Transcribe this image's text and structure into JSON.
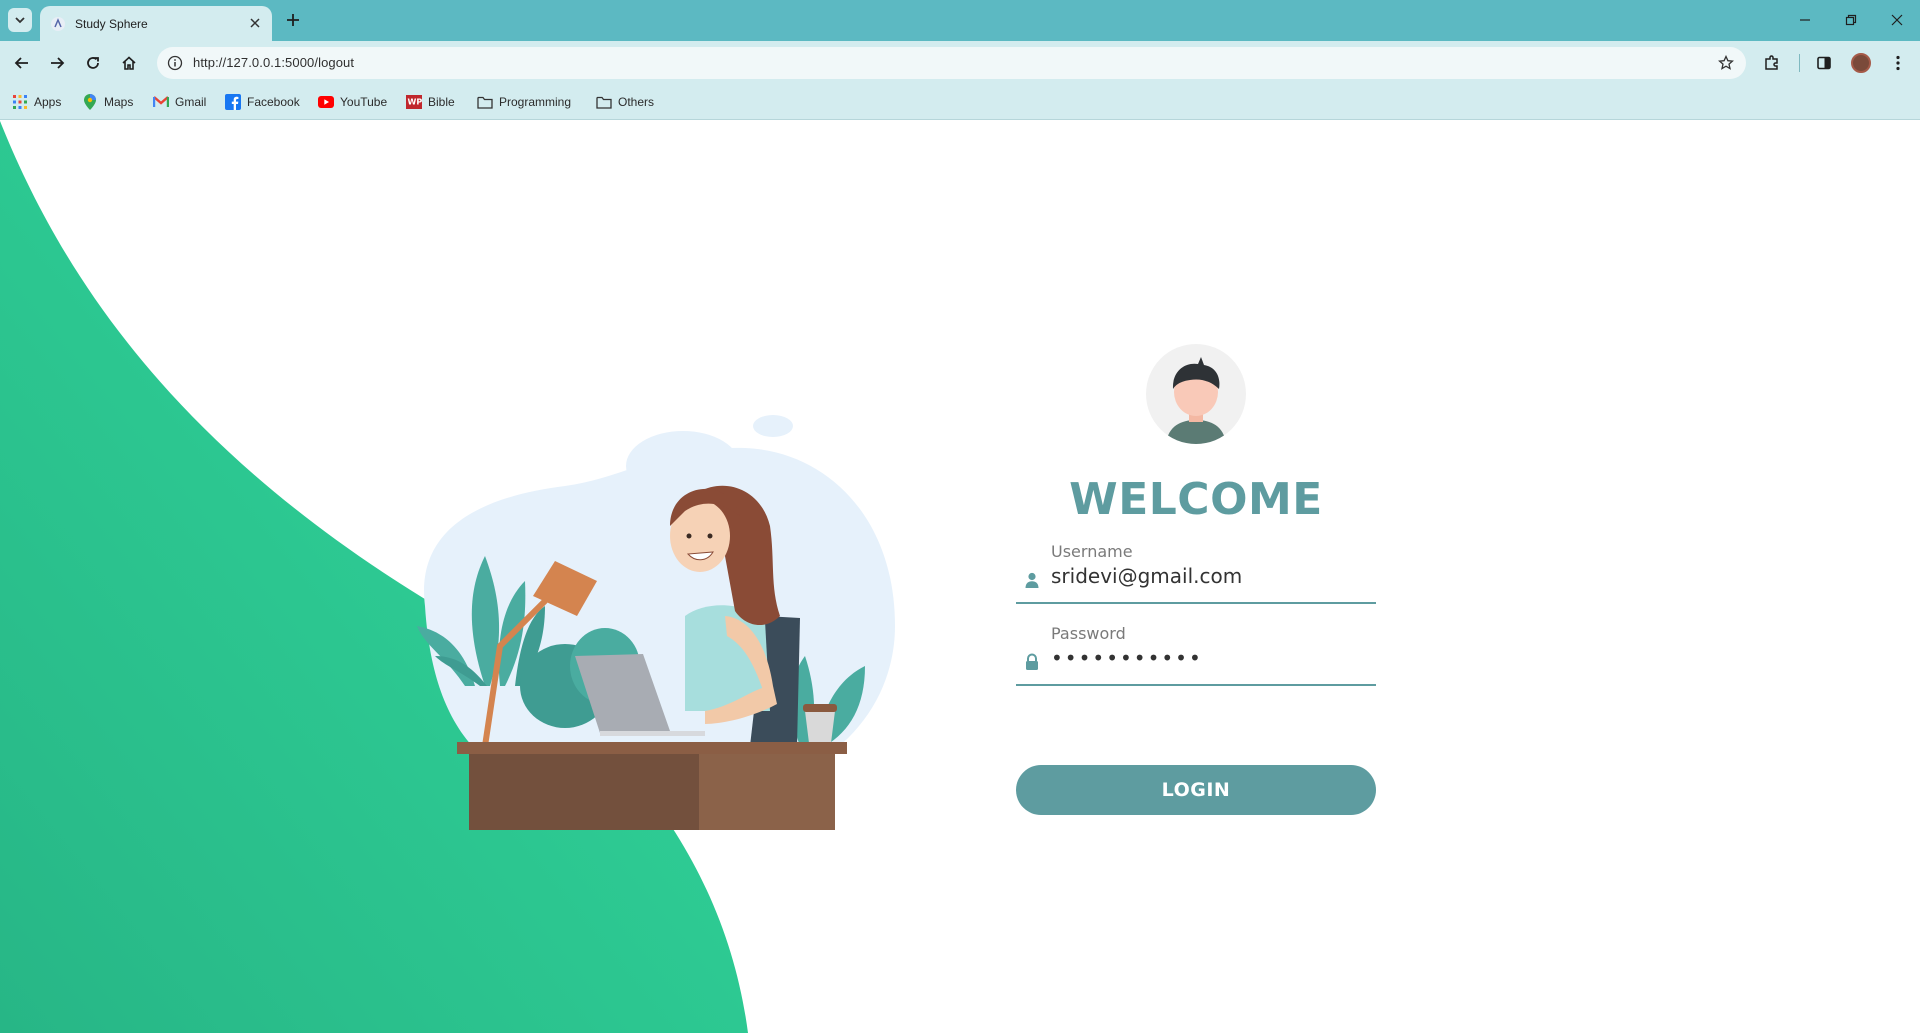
{
  "browser": {
    "tab_title": "Study Sphere",
    "url": "http://127.0.0.1:5000/logout",
    "icons": [
      "tab-search-icon",
      "close-icon",
      "plus-icon",
      "minimize-icon",
      "restore-icon",
      "close-window-icon",
      "back-icon",
      "forward-icon",
      "reload-icon",
      "home-icon",
      "site-info-icon",
      "star-icon",
      "extensions-icon",
      "side-panel-icon",
      "profile-icon",
      "menu-icon"
    ]
  },
  "bookmarks": [
    {
      "label": "Apps",
      "icon": "apps-grid-icon"
    },
    {
      "label": "Maps",
      "icon": "maps-pin-icon"
    },
    {
      "label": "Gmail",
      "icon": "gmail-icon"
    },
    {
      "label": "Facebook",
      "icon": "facebook-icon"
    },
    {
      "label": "YouTube",
      "icon": "youtube-icon"
    },
    {
      "label": "Bible",
      "icon": "bible-icon"
    },
    {
      "label": "Programming",
      "icon": "folder-icon"
    },
    {
      "label": "Others",
      "icon": "folder-icon"
    }
  ],
  "login": {
    "heading": "WELCOME",
    "username_label": "Username",
    "username_value": "sridevi@gmail.com",
    "password_label": "Password",
    "password_value": "•••••••••••",
    "button_label": "LOGIN"
  },
  "colors": {
    "chrome": "#5cb9c2",
    "toolbar": "#d3ecef",
    "accent": "#5e9ca0",
    "wave": "#2ecc94"
  }
}
